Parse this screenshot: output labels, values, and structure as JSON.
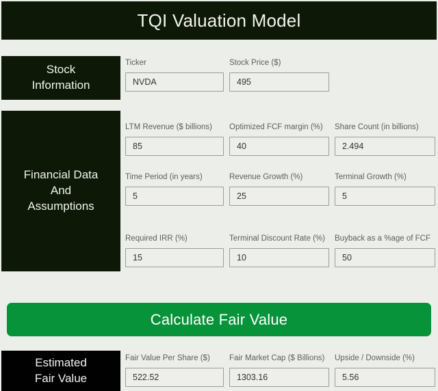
{
  "header": {
    "title": "TQI Valuation Model"
  },
  "colors": {
    "page_background": "#eceeea",
    "header_background": "#0d1806",
    "section_label_background": "#0d1806",
    "result_label_background": "#010101",
    "accent_button": "#069339",
    "input_border": "#9a9c98",
    "label_text": "#5d5f5b"
  },
  "sections": {
    "stock": {
      "label_line1": "Stock",
      "label_line2": "Information",
      "fields": [
        {
          "label": "Ticker",
          "value": "NVDA"
        },
        {
          "label": "Stock Price ($)",
          "value": "495"
        }
      ]
    },
    "financial": {
      "label_line1": "Financial Data",
      "label_line2": "And",
      "label_line3": "Assumptions",
      "fields": [
        {
          "label": "LTM Revenue ($ billions)",
          "value": "85"
        },
        {
          "label": "Optimized FCF margin (%)",
          "value": "40"
        },
        {
          "label": "Share Count (in billions)",
          "value": "2.494"
        },
        {
          "label": "Time Period (in years)",
          "value": "5"
        },
        {
          "label": "Revenue Growth (%)",
          "value": "25"
        },
        {
          "label": "Terminal Growth (%)",
          "value": "5"
        },
        {
          "label": "Required IRR (%)",
          "value": "15"
        },
        {
          "label": "Terminal Discount Rate (%)",
          "value": "10"
        },
        {
          "label": "Buyback as a %age of FCF",
          "value": "50"
        }
      ]
    },
    "estimated": {
      "label_line1": "Estimated",
      "label_line2": "Fair Value",
      "fields": [
        {
          "label": "Fair Value Per Share ($)",
          "value": "522.52"
        },
        {
          "label": "Fair Market Cap ($ Billions)",
          "value": "1303.16"
        },
        {
          "label": "Upside / Downside (%)",
          "value": "5.56"
        }
      ]
    }
  },
  "actions": {
    "calculate_label": "Calculate Fair Value"
  }
}
